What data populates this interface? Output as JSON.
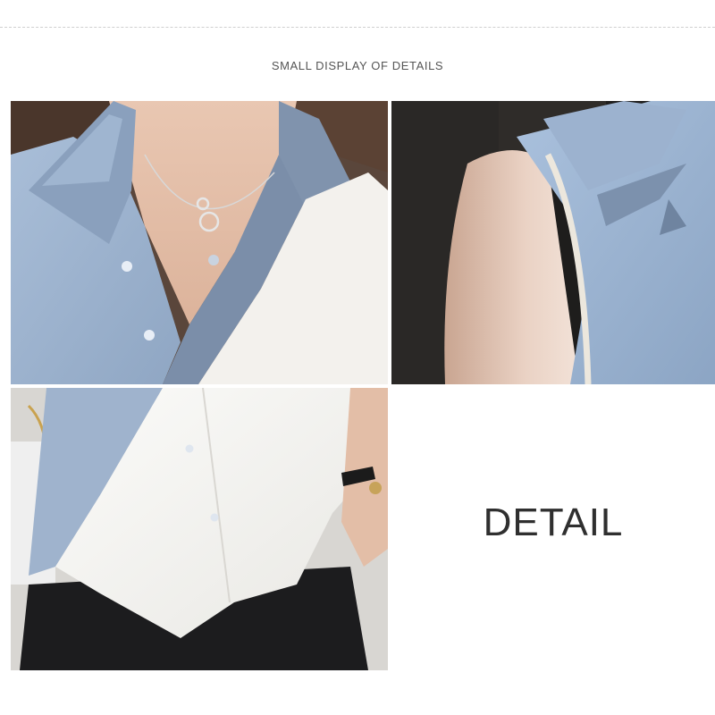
{
  "header": {
    "title": "SMALL DISPLAY OF DETAILS"
  },
  "photos": [
    {
      "subject": "collar-and-necklace-closeup"
    },
    {
      "subject": "sleeveless-shoulder-closeup"
    },
    {
      "subject": "button-placket-and-hem-closeup"
    }
  ],
  "detail_label": "DETAIL",
  "colors": {
    "blouse_blue": "#9db3cf",
    "blouse_blue_shadow": "#7d93ae",
    "blouse_white": "#f4f3ef",
    "skin": "#e7c3ad",
    "trousers": "#1d1d1f",
    "background_dark": "#2a2623"
  }
}
